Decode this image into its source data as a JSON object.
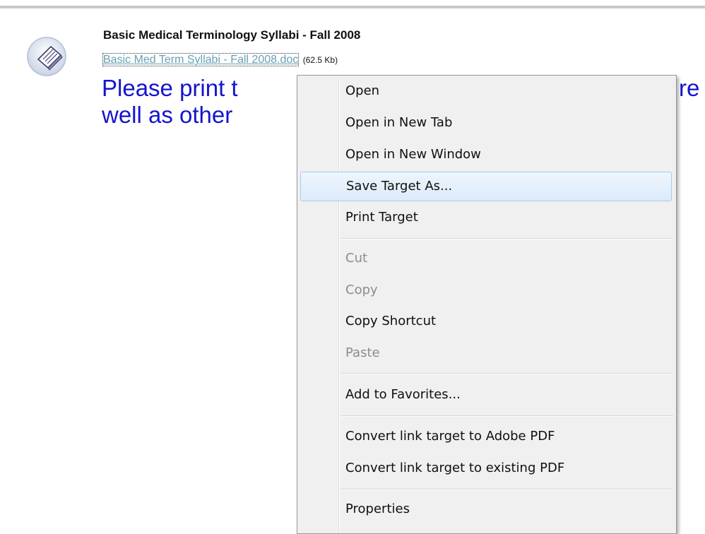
{
  "page": {
    "title": "Basic Medical Terminology Syllabi - Fall 2008",
    "file_link": "Basic Med Term Syllabi - Fall 2008.doc",
    "file_size": "(62.5 Kb)",
    "notice_line1_visible": "Please print t",
    "notice_line1_right_fragment": "re",
    "notice_line2_visible": "well as other",
    "icon": "document-attachment-icon"
  },
  "context_menu": {
    "open": "Open",
    "open_new_tab": "Open in New Tab",
    "open_new_window": "Open in New Window",
    "save_target_as": "Save Target As...",
    "print_target": "Print Target",
    "cut": "Cut",
    "copy": "Copy",
    "copy_shortcut": "Copy Shortcut",
    "paste": "Paste",
    "add_to_favorites": "Add to Favorites...",
    "convert_to_adobe_pdf": "Convert link target to Adobe PDF",
    "convert_to_existing_pdf": "Convert link target to existing PDF",
    "properties": "Properties",
    "highlighted_item": "Save Target As..."
  },
  "colors": {
    "link": "#66a0b3",
    "notice_text": "#1414cf",
    "menu_background": "#f0f0f0",
    "menu_highlight_border": "#a9c9ea",
    "disabled_text": "#8c8c8c"
  }
}
